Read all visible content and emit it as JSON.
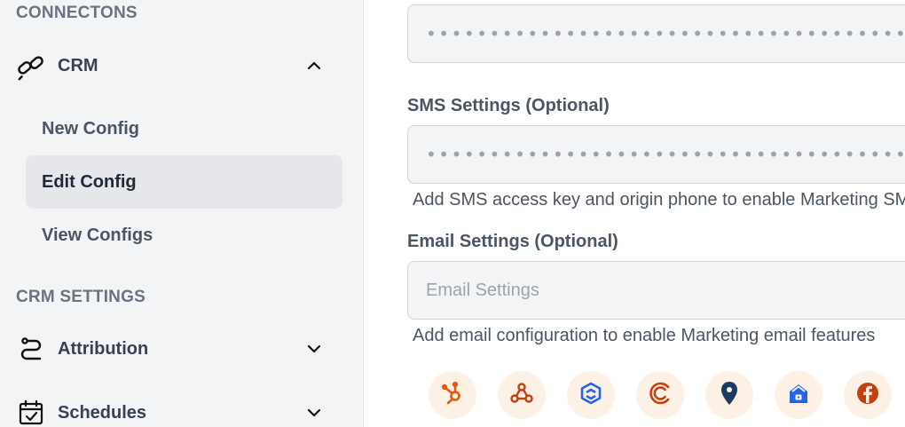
{
  "sidebar": {
    "connections_header": "CONNECTONS",
    "crm": {
      "label": "CRM",
      "expanded": true
    },
    "crm_items": [
      {
        "label": "New Config",
        "active": false
      },
      {
        "label": "Edit Config",
        "active": true
      },
      {
        "label": "View Configs",
        "active": false
      }
    ],
    "crm_settings_header": "CRM SETTINGS",
    "attribution": {
      "label": "Attribution"
    },
    "schedules": {
      "label": "Schedules"
    }
  },
  "form": {
    "top_field": {
      "value": "••••••••••••••••••••••••••••••••••••••••••••••••••"
    },
    "sms": {
      "label": "SMS Settings (Optional)",
      "value": "••••••••••••••••••••••••••••••••••••••••••••••••••",
      "helper": "Add SMS access key and origin phone to enable Marketing SMS features"
    },
    "email": {
      "label": "Email Settings (Optional)",
      "placeholder": "Email Settings",
      "helper": "Add email configuration to enable Marketing email features"
    }
  },
  "integrations": [
    {
      "name": "hubspot-icon",
      "color": "#ea580c"
    },
    {
      "name": "webhook-icon",
      "color": "#c2410c"
    },
    {
      "name": "cube-icon",
      "color": "#2563eb"
    },
    {
      "name": "c-brand-icon",
      "color": "#c2410c"
    },
    {
      "name": "location-pin-icon",
      "color": "#1e3a5f"
    },
    {
      "name": "home-lock-icon",
      "color": "#2563eb"
    },
    {
      "name": "facebook-icon",
      "color": "#c2410c"
    }
  ],
  "colors": {
    "sidebar_bg": "#f3f4f6",
    "active_item_bg": "#e5e7eb",
    "integration_bg": "#fdf1e6"
  }
}
